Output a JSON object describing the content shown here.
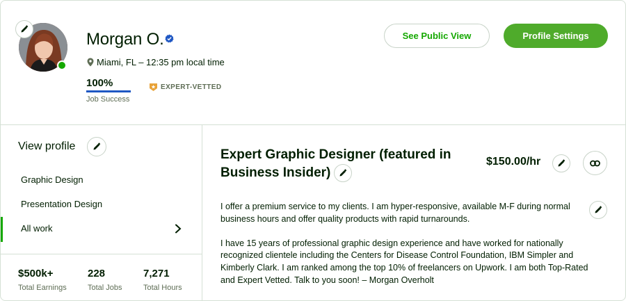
{
  "profile": {
    "name": "Morgan O.",
    "location": "Miami, FL – 12:35 pm local time",
    "job_success": "100%",
    "job_success_fraction": 1.0,
    "job_success_label": "Job Success",
    "badge": "EXPERT-VETTED"
  },
  "actions": {
    "public_view": "See Public View",
    "settings": "Profile Settings"
  },
  "sidebar": {
    "title": "View profile",
    "specializations": [
      "Graphic Design",
      "Presentation Design",
      "All work"
    ],
    "stats": [
      {
        "value": "$500k+",
        "label": "Total Earnings"
      },
      {
        "value": "228",
        "label": "Total Jobs"
      },
      {
        "value": "7,271",
        "label": "Total Hours"
      }
    ]
  },
  "main": {
    "title_line1": "Expert Graphic Designer (featured in",
    "title_line2": "Business Insider)",
    "rate": "$150.00/hr",
    "description_p1": "I offer a premium service to my clients. I am hyper-responsive, available M-F during normal business hours and offer quality products with rapid turnarounds.",
    "description_p2": "I have 15 years of professional graphic design experience and have worked for nationally recognized clientele including the Centers for Disease Control Foundation, IBM Simpler and Kimberly Clark. I am ranked among the top 10% of freelancers on Upwork. I am both Top-Rated and Expert Vetted. Talk to you soon! – Morgan Overholt"
  },
  "colors": {
    "brand_green": "#14a800",
    "button_green": "#4fab2b",
    "jss_blue": "#1f57c3",
    "badge_gold": "#e8a33a"
  },
  "icons": [
    "pencil-icon",
    "verified-badge-icon",
    "location-pin-icon",
    "expert-vetted-icon",
    "chevron-right-icon",
    "link-icon"
  ]
}
